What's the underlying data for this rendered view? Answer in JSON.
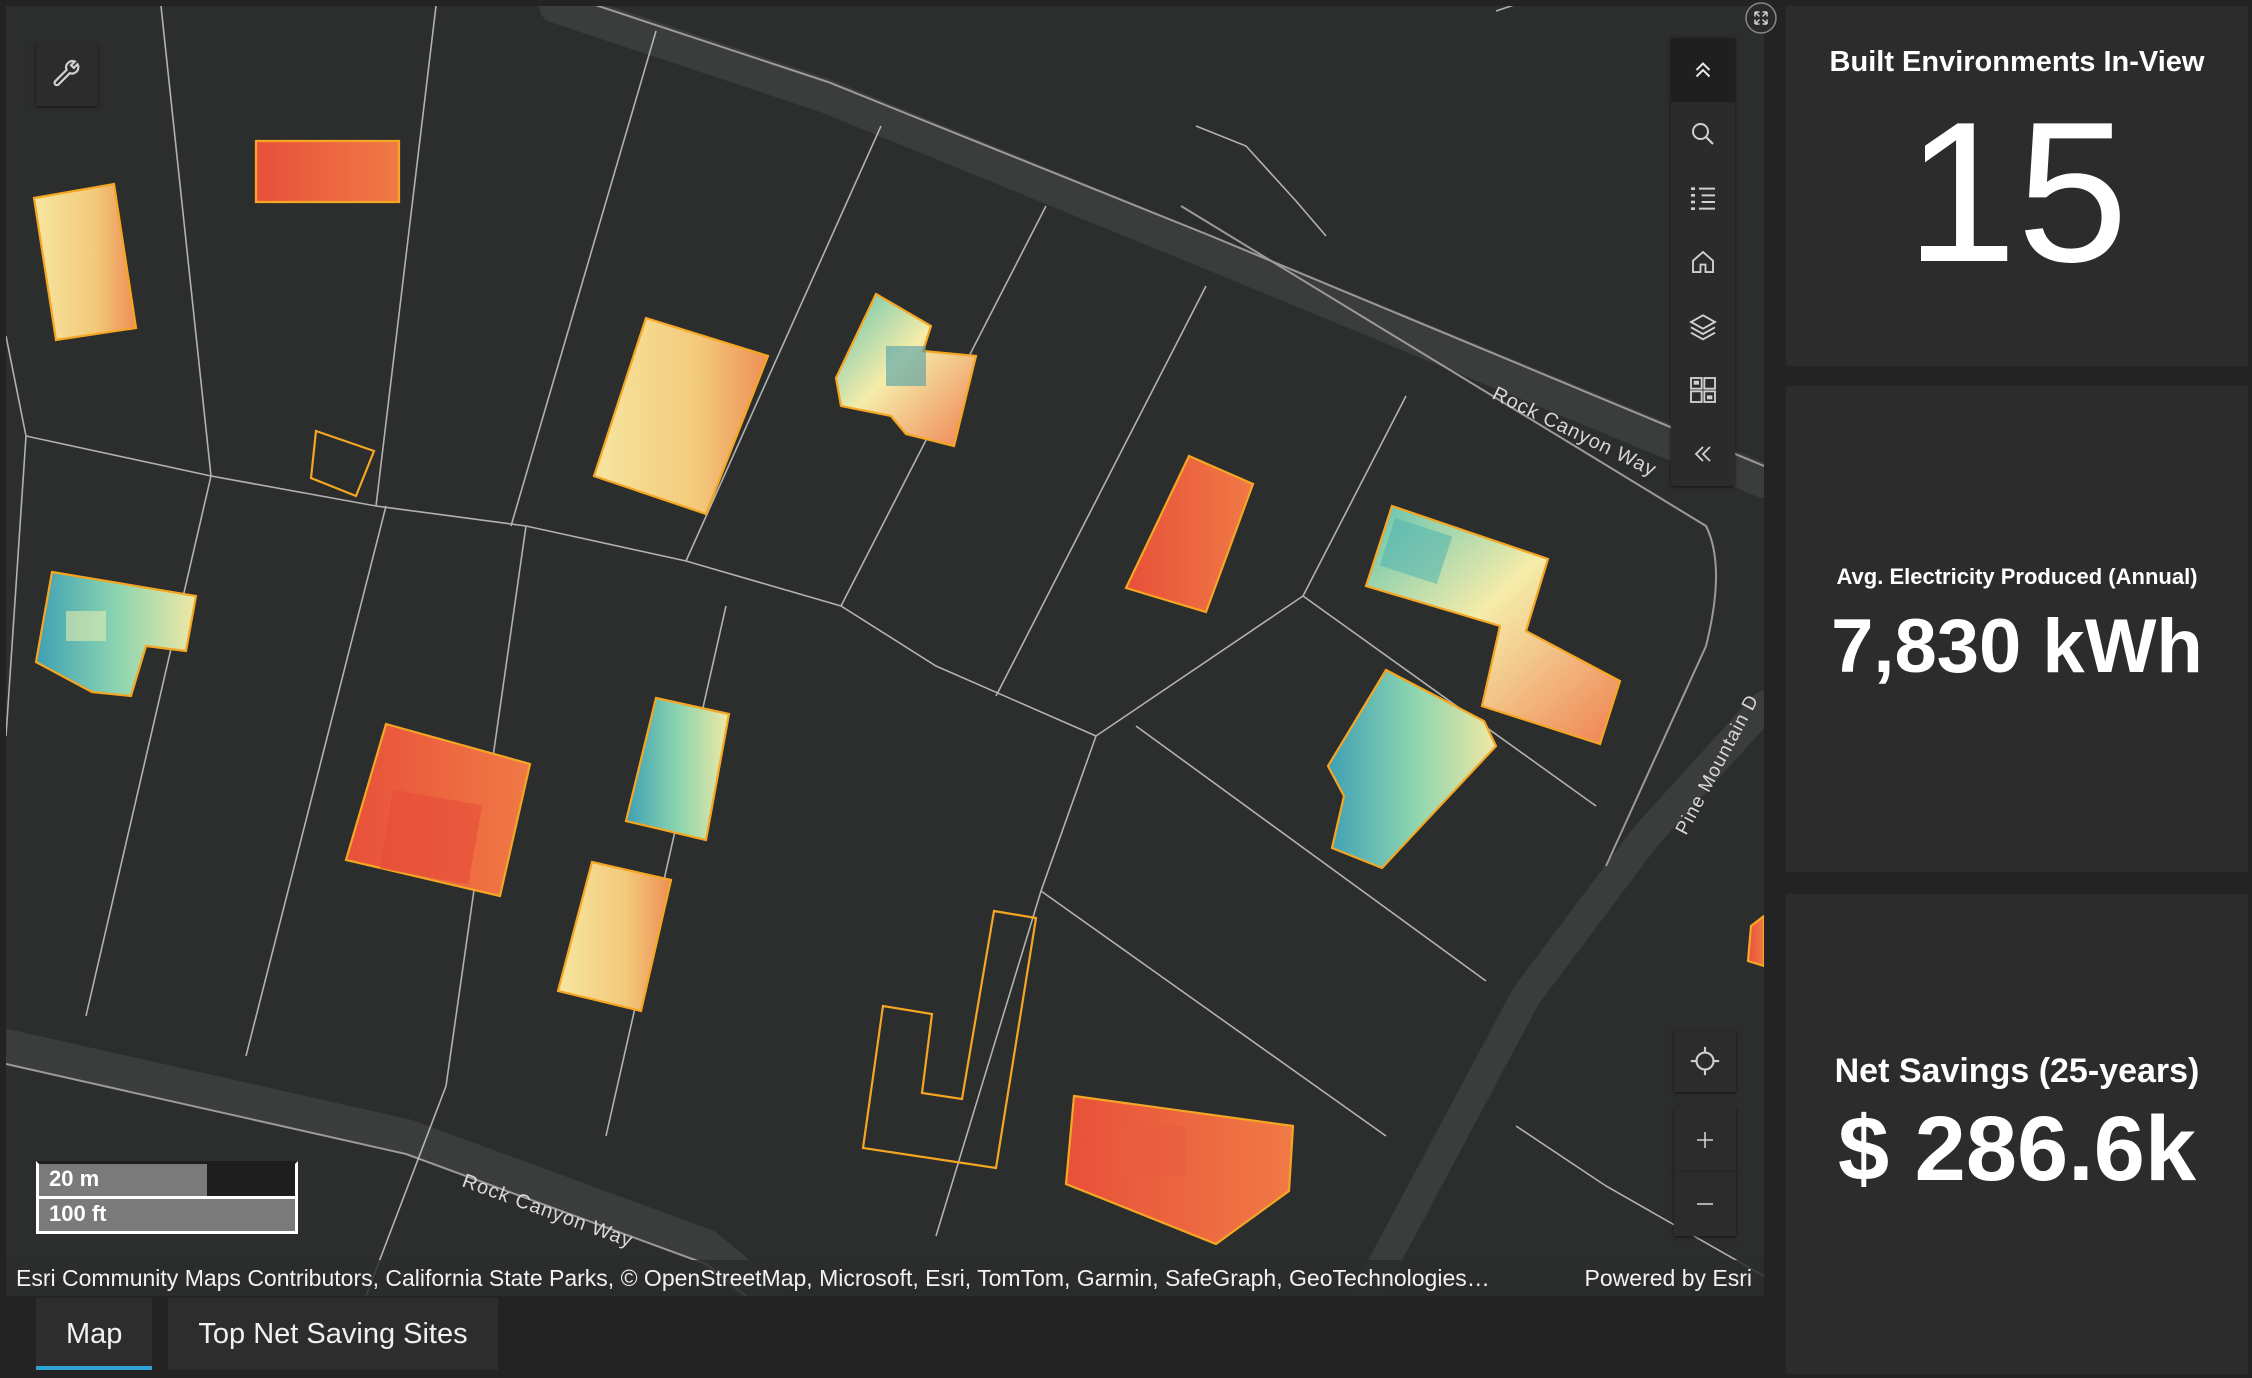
{
  "map": {
    "street_labels": [
      "Rock Canyon Way",
      "Rock Canyon Way",
      "Pine Mountain D"
    ],
    "scalebar": {
      "metric": "20 m",
      "imperial": "100 ft"
    },
    "attribution": "Esri Community Maps Contributors, California State Parks, © OpenStreetMap, Microsoft, Esri, TomTom, Garmin, SafeGraph, GeoTechnologies…",
    "powered_by": "Powered by Esri",
    "toolbar_icons": [
      "collapse-up-icon",
      "search-icon",
      "legend-list-icon",
      "home-icon",
      "layers-icon",
      "basemap-gallery-icon",
      "collapse-left-icon"
    ],
    "nav_icons": [
      "locate-icon",
      "zoom-in-icon",
      "zoom-out-icon"
    ],
    "colors": {
      "background": "#2c2d2d",
      "roads": "#3a3b3b",
      "parcel_lines": "#bdbdbd",
      "building_outline": "#f5a623"
    }
  },
  "tabs": [
    {
      "label": "Map",
      "active": true
    },
    {
      "label": "Top Net Saving Sites",
      "active": false
    }
  ],
  "indicators": {
    "built_environments": {
      "title": "Built Environments In-View",
      "value": "15"
    },
    "electricity": {
      "title": "Avg. Electricity Produced (Annual)",
      "value": "7,830 kWh"
    },
    "savings": {
      "title": "Net Savings (25-years)",
      "value": "$ 286.6k"
    }
  }
}
